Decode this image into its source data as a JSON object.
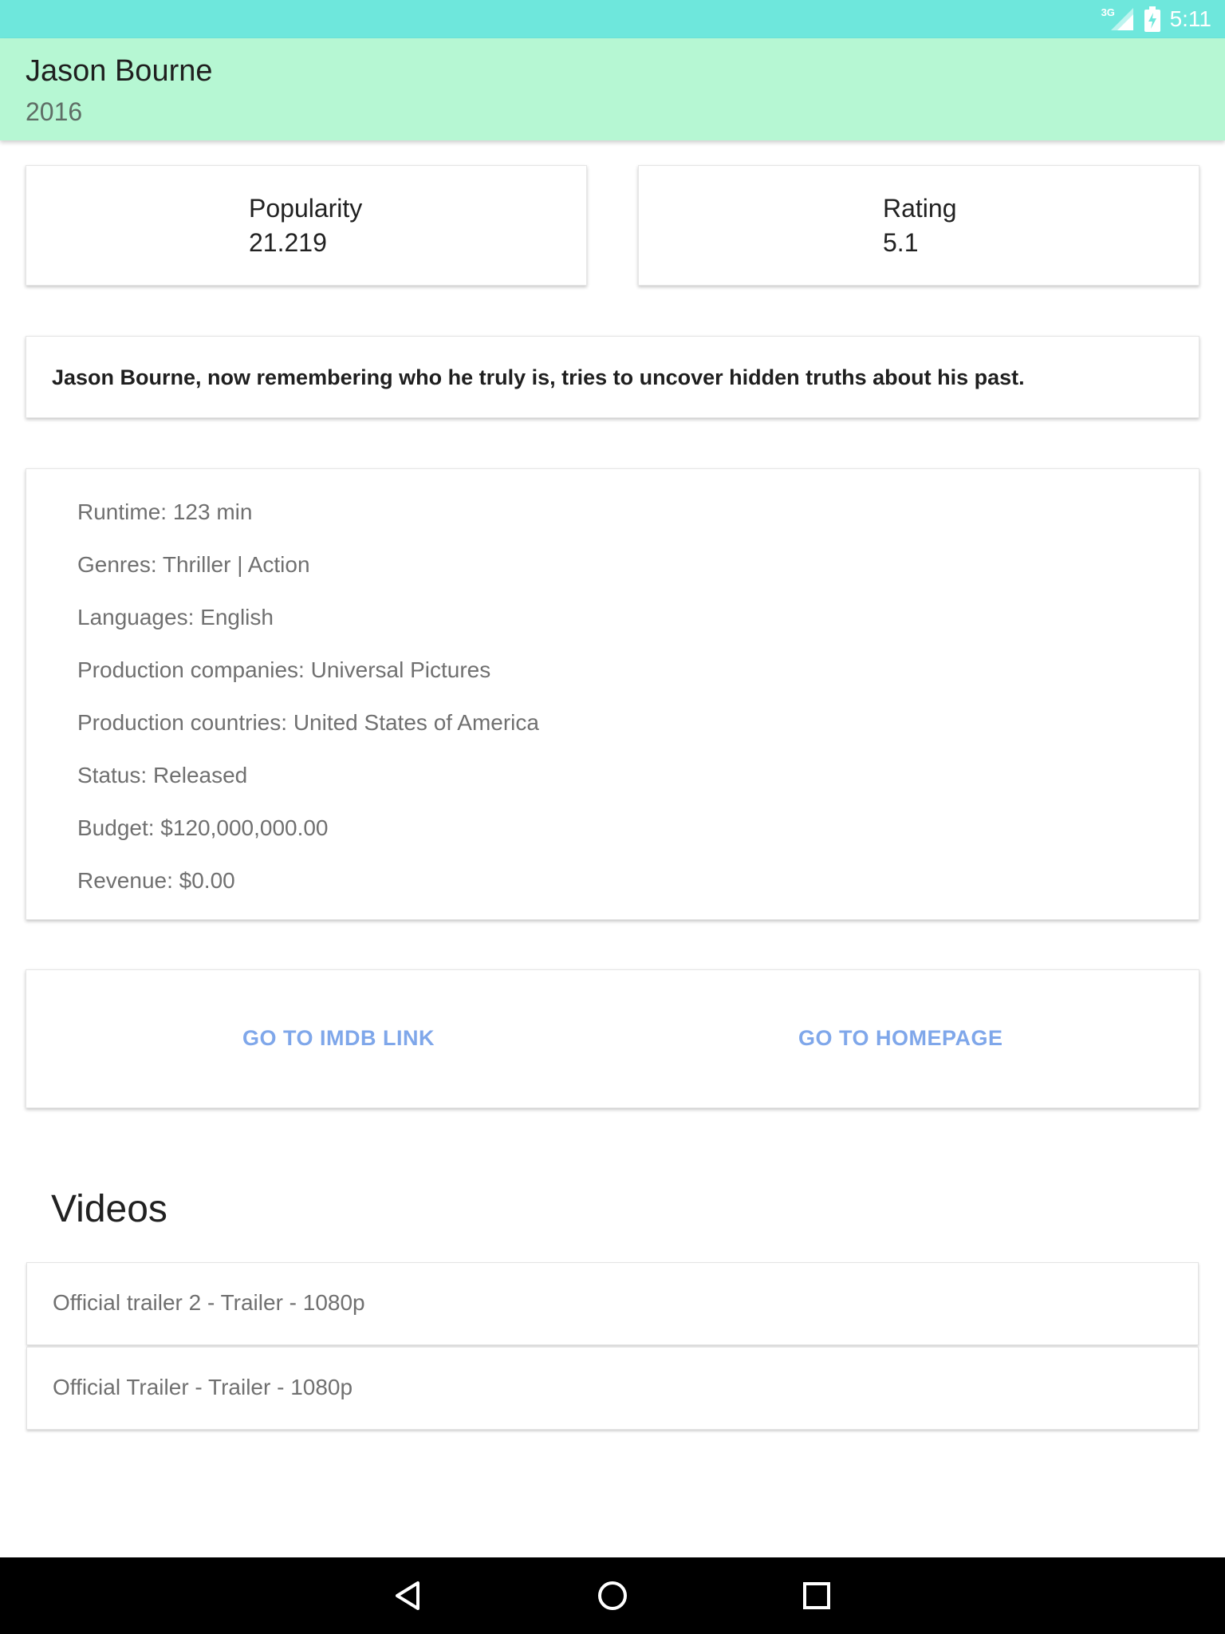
{
  "status_bar": {
    "network": "3G",
    "time": "5:11",
    "icons": [
      "signal-icon",
      "battery-charging-icon"
    ]
  },
  "app_bar": {
    "title": "Jason Bourne",
    "subtitle": "2016"
  },
  "stats": {
    "popularity": {
      "label": "Popularity",
      "value": "21.219"
    },
    "rating": {
      "label": "Rating",
      "value": "5.1"
    }
  },
  "overview": "Jason Bourne, now remembering who he truly is, tries to uncover hidden truths about his past.",
  "details": [
    "Runtime: 123 min",
    "Genres: Thriller | Action",
    "Languages: English",
    "Production companies: Universal Pictures",
    "Production countries: United States of America",
    "Status: Released",
    "Budget: $120,000,000.00",
    "Revenue: $0.00"
  ],
  "links": {
    "imdb": "GO TO IMDB LINK",
    "homepage": "GO TO HOMEPAGE",
    "color": "#7fa7ea"
  },
  "videos": {
    "heading": "Videos",
    "items": [
      "Official trailer 2 - Trailer - 1080p",
      "Official Trailer - Trailer - 1080p"
    ]
  },
  "nav_bar": {
    "icons": [
      "back-icon",
      "home-icon",
      "recents-icon"
    ]
  },
  "colors": {
    "status_bar": "#6ee7dc",
    "app_bar": "#b6f7d3"
  }
}
